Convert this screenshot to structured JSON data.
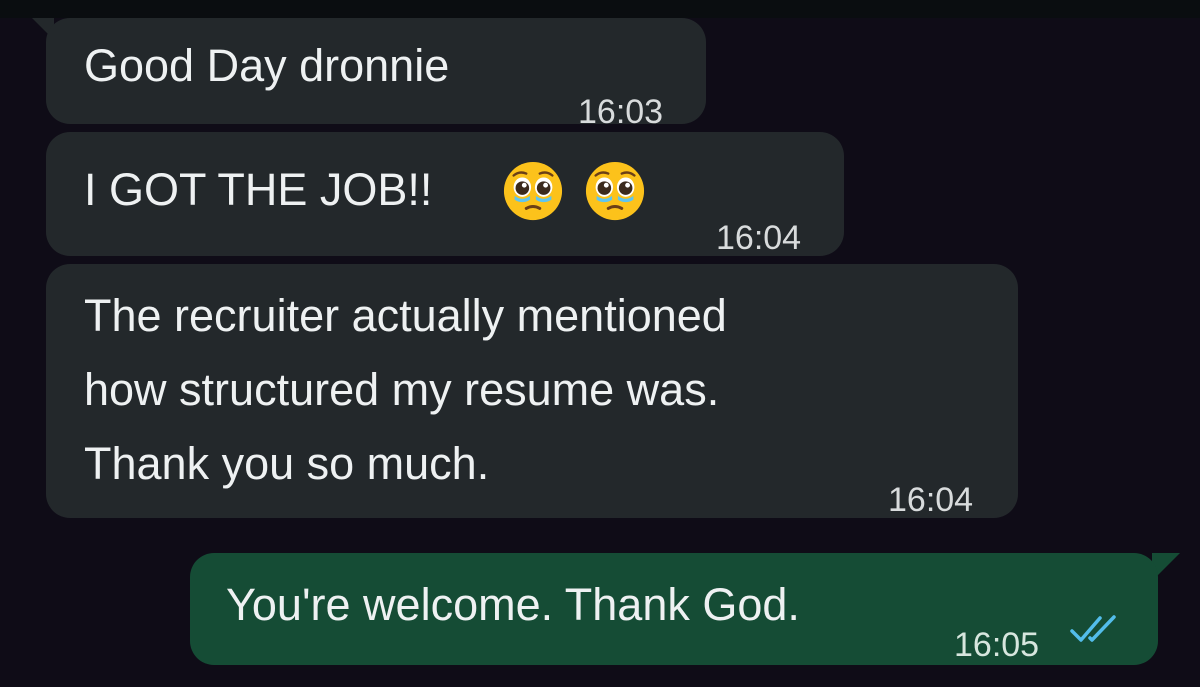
{
  "messages": [
    {
      "direction": "incoming",
      "text": "Good Day dronnie",
      "time": "16:03"
    },
    {
      "direction": "incoming",
      "text": "I GOT THE JOB!!",
      "emojis": [
        "pleading-face",
        "pleading-face"
      ],
      "time": "16:04"
    },
    {
      "direction": "incoming",
      "lines": [
        "The recruiter actually mentioned",
        "how structured my resume was.",
        "Thank you so much."
      ],
      "time": "16:04"
    },
    {
      "direction": "outgoing",
      "text": "You're welcome. Thank God.",
      "time": "16:05",
      "status": "read",
      "status_icon": "double-check-icon"
    }
  ],
  "colors": {
    "background": "#0f0c17",
    "incoming_bubble": "#23282b",
    "outgoing_bubble": "#154c35",
    "read_ticks": "#53bdeb"
  }
}
